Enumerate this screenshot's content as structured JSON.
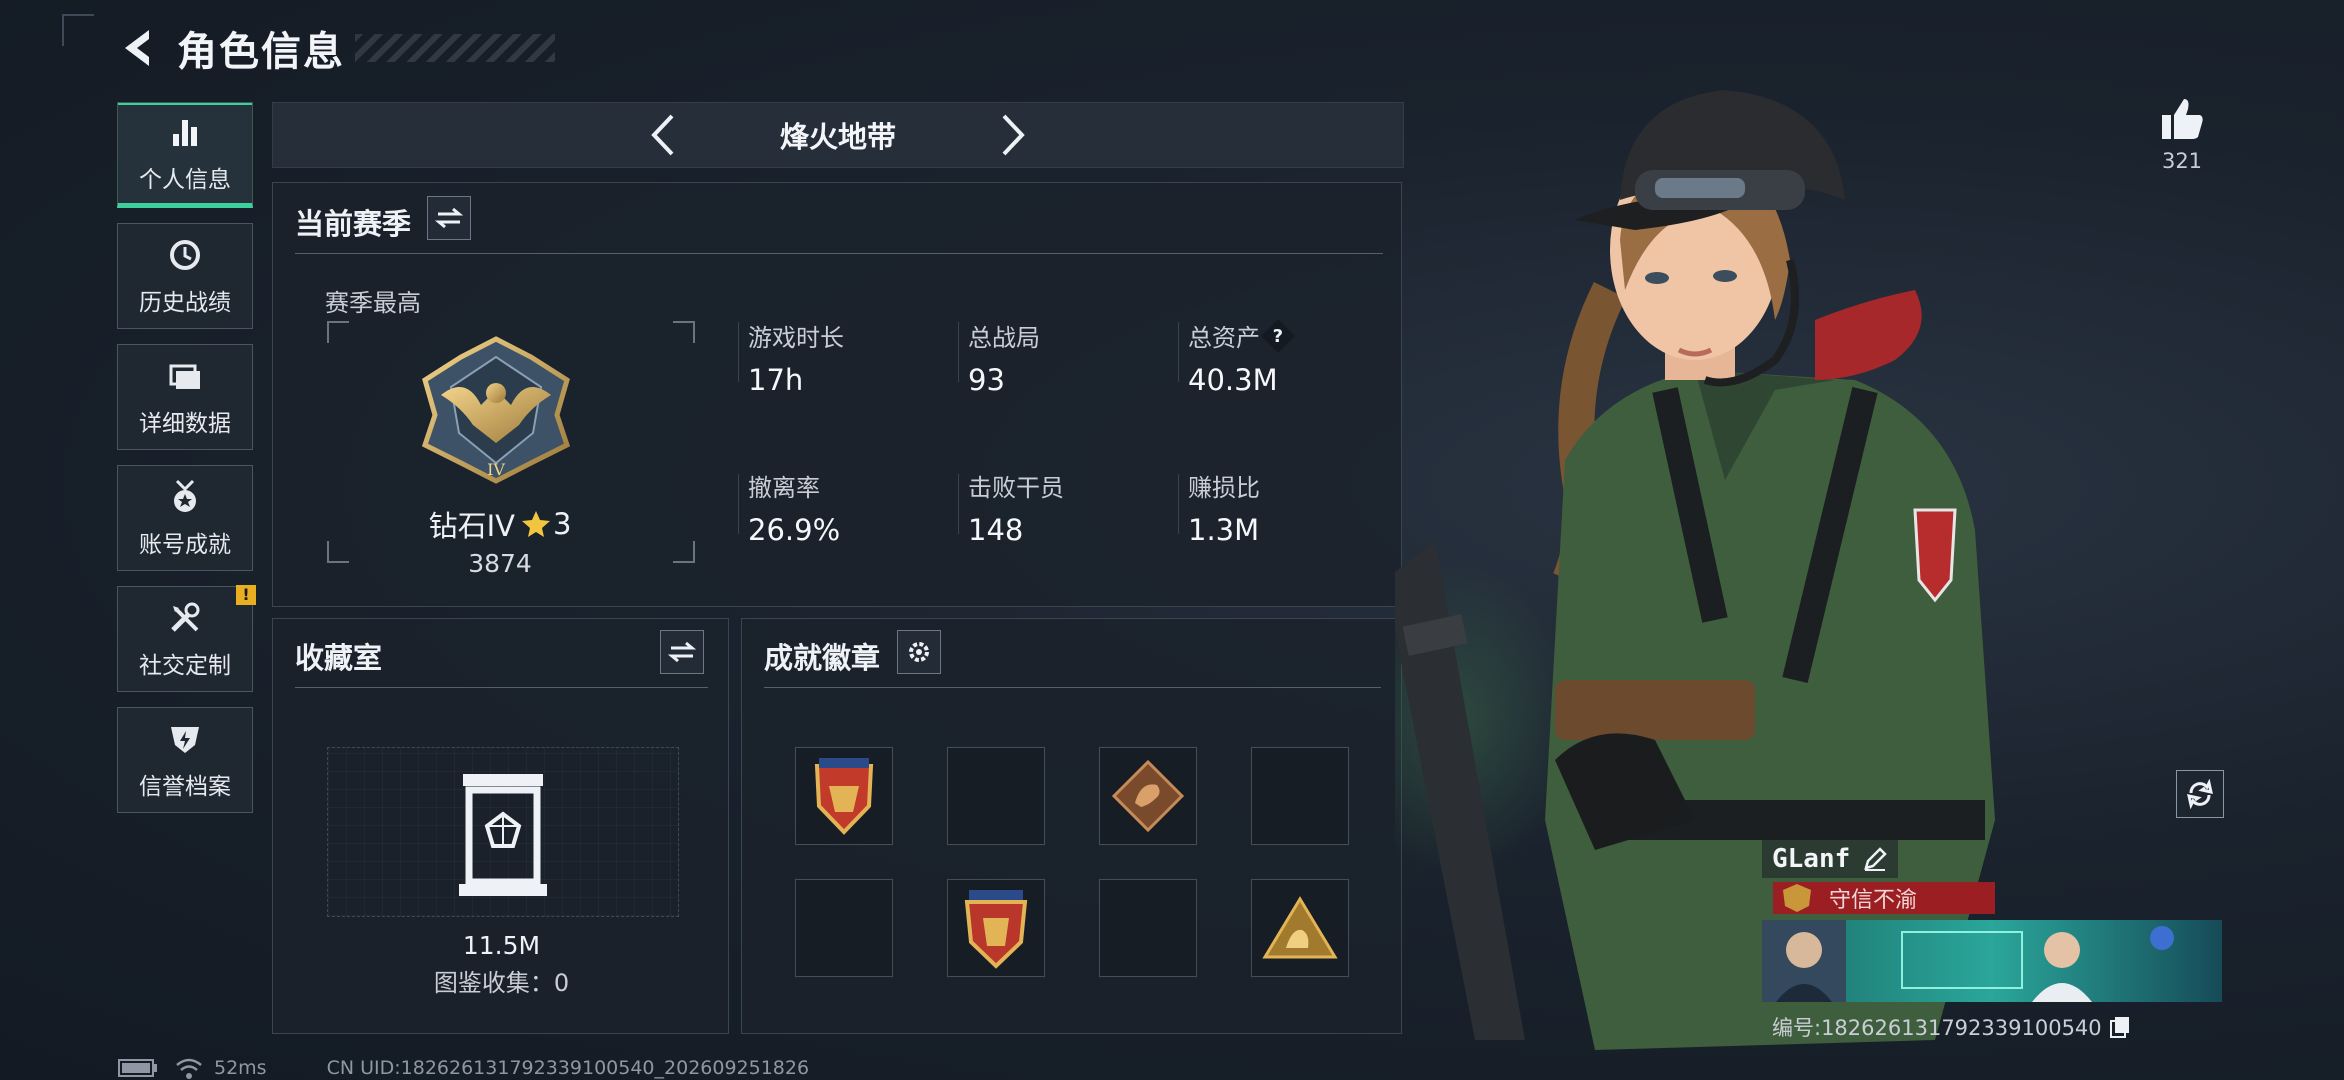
{
  "header": {
    "title": "角色信息"
  },
  "sidebar": {
    "items": [
      {
        "label": "个人信息",
        "icon": "bar-chart-icon",
        "active": true
      },
      {
        "label": "历史战绩",
        "icon": "history-clock-icon"
      },
      {
        "label": "详细数据",
        "icon": "folder-icon"
      },
      {
        "label": "账号成就",
        "icon": "medal-icon"
      },
      {
        "label": "社交定制",
        "icon": "tools-icon",
        "notice": "!"
      },
      {
        "label": "信誉档案",
        "icon": "shield-bolt-icon"
      }
    ]
  },
  "mode": {
    "title": "烽火地带"
  },
  "season": {
    "title": "当前赛季",
    "best_label": "赛季最高",
    "rank": "钻石IV",
    "rank_stars": "3",
    "score": "3874",
    "stats": [
      {
        "label": "游戏时长",
        "value": "17h"
      },
      {
        "label": "总战局",
        "value": "93"
      },
      {
        "label": "总资产",
        "value": "40.3M",
        "help": "?"
      },
      {
        "label": "撤离率",
        "value": "26.9%"
      },
      {
        "label": "击败干员",
        "value": "148"
      },
      {
        "label": "赚损比",
        "value": "1.3M"
      }
    ]
  },
  "collection": {
    "title": "收藏室",
    "value": "11.5M",
    "count_label": "图鉴收集：0"
  },
  "badges": {
    "title": "成就徽章"
  },
  "likes": {
    "count": "321"
  },
  "player": {
    "name": "GLanf",
    "motto": "守信不渝",
    "id_text": "编号:18262613179233910054​0"
  },
  "status": {
    "ping": "52ms",
    "uid": "CN UID:18262613179233910054​0_202609251826"
  },
  "colors": {
    "accent": "#3fcf9b",
    "motto_bg": "#9b1f22",
    "notice": "#e8b020"
  }
}
